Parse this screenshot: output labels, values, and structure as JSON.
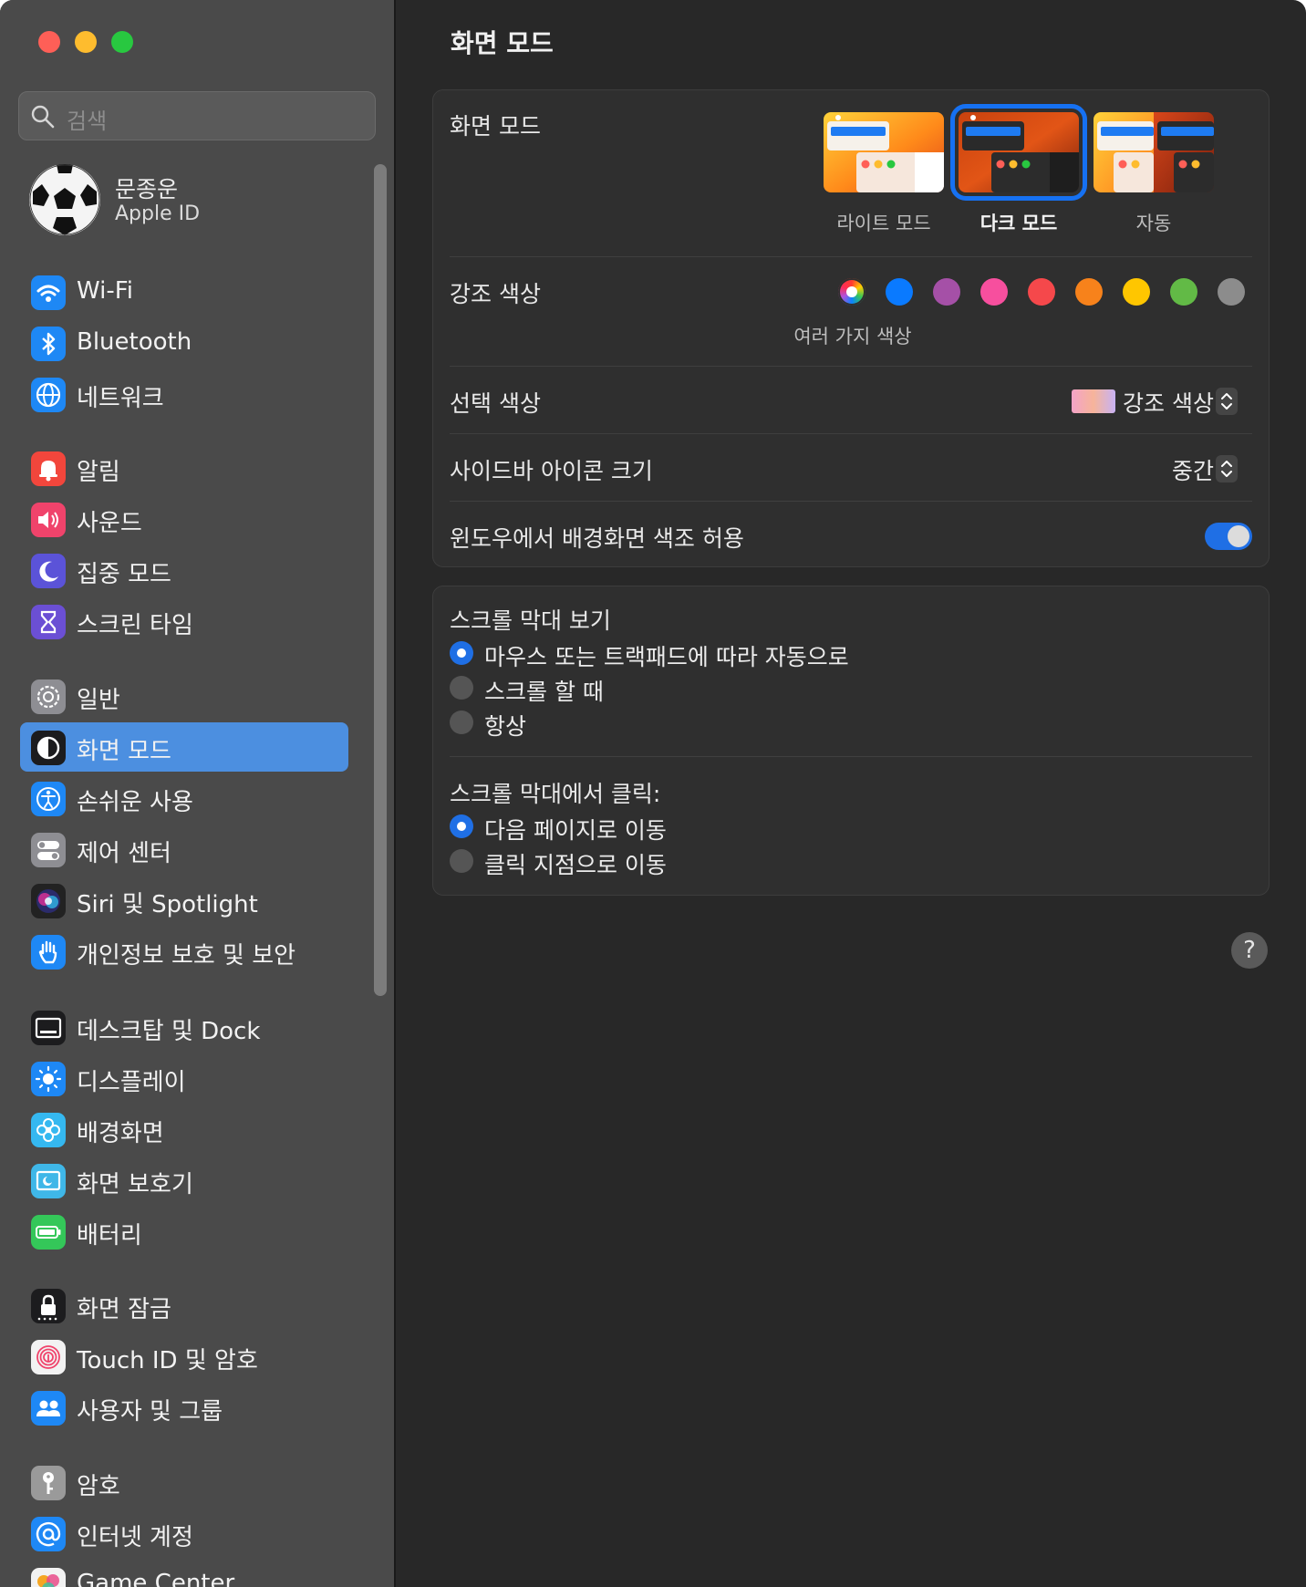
{
  "window": {
    "traffic": [
      "close",
      "minimize",
      "zoom"
    ]
  },
  "sidebar": {
    "search": {
      "placeholder": "검색"
    },
    "profile": {
      "name": "문종운",
      "subtitle": "Apple ID"
    },
    "items": [
      {
        "label": "Wi-Fi",
        "icon": "wifi-icon",
        "color": "#1e88f5"
      },
      {
        "label": "Bluetooth",
        "icon": "bluetooth-icon",
        "color": "#1e88f5"
      },
      {
        "label": "네트워크",
        "icon": "globe-icon",
        "color": "#1e88f5"
      },
      {
        "label": "알림",
        "icon": "bell-icon",
        "color": "#f2463c"
      },
      {
        "label": "사운드",
        "icon": "speaker-icon",
        "color": "#f0436b"
      },
      {
        "label": "집중 모드",
        "icon": "moon-icon",
        "color": "#5b53d8"
      },
      {
        "label": "스크린 타임",
        "icon": "hourglass-icon",
        "color": "#6b4fd4"
      },
      {
        "label": "일반",
        "icon": "gear-icon",
        "color": "#8e8e93"
      },
      {
        "label": "화면 모드",
        "icon": "appearance-icon",
        "color": "#1c1c1e"
      },
      {
        "label": "손쉬운 사용",
        "icon": "accessibility-icon",
        "color": "#1e88f5"
      },
      {
        "label": "제어 센터",
        "icon": "toggles-icon",
        "color": "#8e8e93"
      },
      {
        "label": "Siri 및 Spotlight",
        "icon": "siri-icon",
        "color": "#222"
      },
      {
        "label": "개인정보 보호 및 보안",
        "icon": "hand-icon",
        "color": "#1e88f5"
      },
      {
        "label": "데스크탑 및 Dock",
        "icon": "dock-icon",
        "color": "#1c1c1e"
      },
      {
        "label": "디스플레이",
        "icon": "sun-icon",
        "color": "#1e88f5"
      },
      {
        "label": "배경화면",
        "icon": "flower-icon",
        "color": "#35b8f0"
      },
      {
        "label": "화면 보호기",
        "icon": "screensaver-icon",
        "color": "#3fb7e8"
      },
      {
        "label": "배터리",
        "icon": "battery-icon",
        "color": "#34c759"
      },
      {
        "label": "화면 잠금",
        "icon": "lock-icon",
        "color": "#1c1c1e"
      },
      {
        "label": "Touch ID 및 암호",
        "icon": "fingerprint-icon",
        "color": "#f2f2f2"
      },
      {
        "label": "사용자 및 그룹",
        "icon": "users-icon",
        "color": "#1e88f5"
      },
      {
        "label": "암호",
        "icon": "key-icon",
        "color": "#9a9a9a"
      },
      {
        "label": "인터넷 계정",
        "icon": "at-icon",
        "color": "#1e88f5"
      },
      {
        "label": "Game Center",
        "icon": "gamecenter-icon",
        "color": "#f2f2f2"
      }
    ],
    "active_index": 8
  },
  "main": {
    "title": "화면 모드",
    "appearance": {
      "label": "화면 모드",
      "options": [
        "라이트 모드",
        "다크 모드",
        "자동"
      ],
      "selected_index": 1
    },
    "accent": {
      "label": "강조 색상",
      "caption": "여러 가지 색상",
      "colors": [
        {
          "name": "multicolor",
          "hex": "multi"
        },
        {
          "name": "blue",
          "hex": "#0a7aff"
        },
        {
          "name": "purple",
          "hex": "#a550a7"
        },
        {
          "name": "pink",
          "hex": "#f74f9e"
        },
        {
          "name": "red",
          "hex": "#f5484b"
        },
        {
          "name": "orange",
          "hex": "#f7821b"
        },
        {
          "name": "yellow",
          "hex": "#ffc600"
        },
        {
          "name": "green",
          "hex": "#62ba46"
        },
        {
          "name": "graphite",
          "hex": "#8c8c8c"
        }
      ],
      "selected_index": 0
    },
    "highlight": {
      "label": "선택 색상",
      "value": "강조 색상"
    },
    "sidebar_icon_size": {
      "label": "사이드바 아이콘 크기",
      "value": "중간"
    },
    "tinting": {
      "label": "윈도우에서 배경화면 색조 허용",
      "on": true
    },
    "scrollbars": {
      "label": "스크롤 막대 보기",
      "options": [
        "마우스 또는 트랙패드에 따라 자동으로",
        "스크롤 할 때",
        "항상"
      ],
      "selected_index": 0
    },
    "click": {
      "label": "스크롤 막대에서 클릭:",
      "options": [
        "다음 페이지로 이동",
        "클릭 지점으로 이동"
      ],
      "selected_index": 0
    },
    "help_label": "?"
  }
}
